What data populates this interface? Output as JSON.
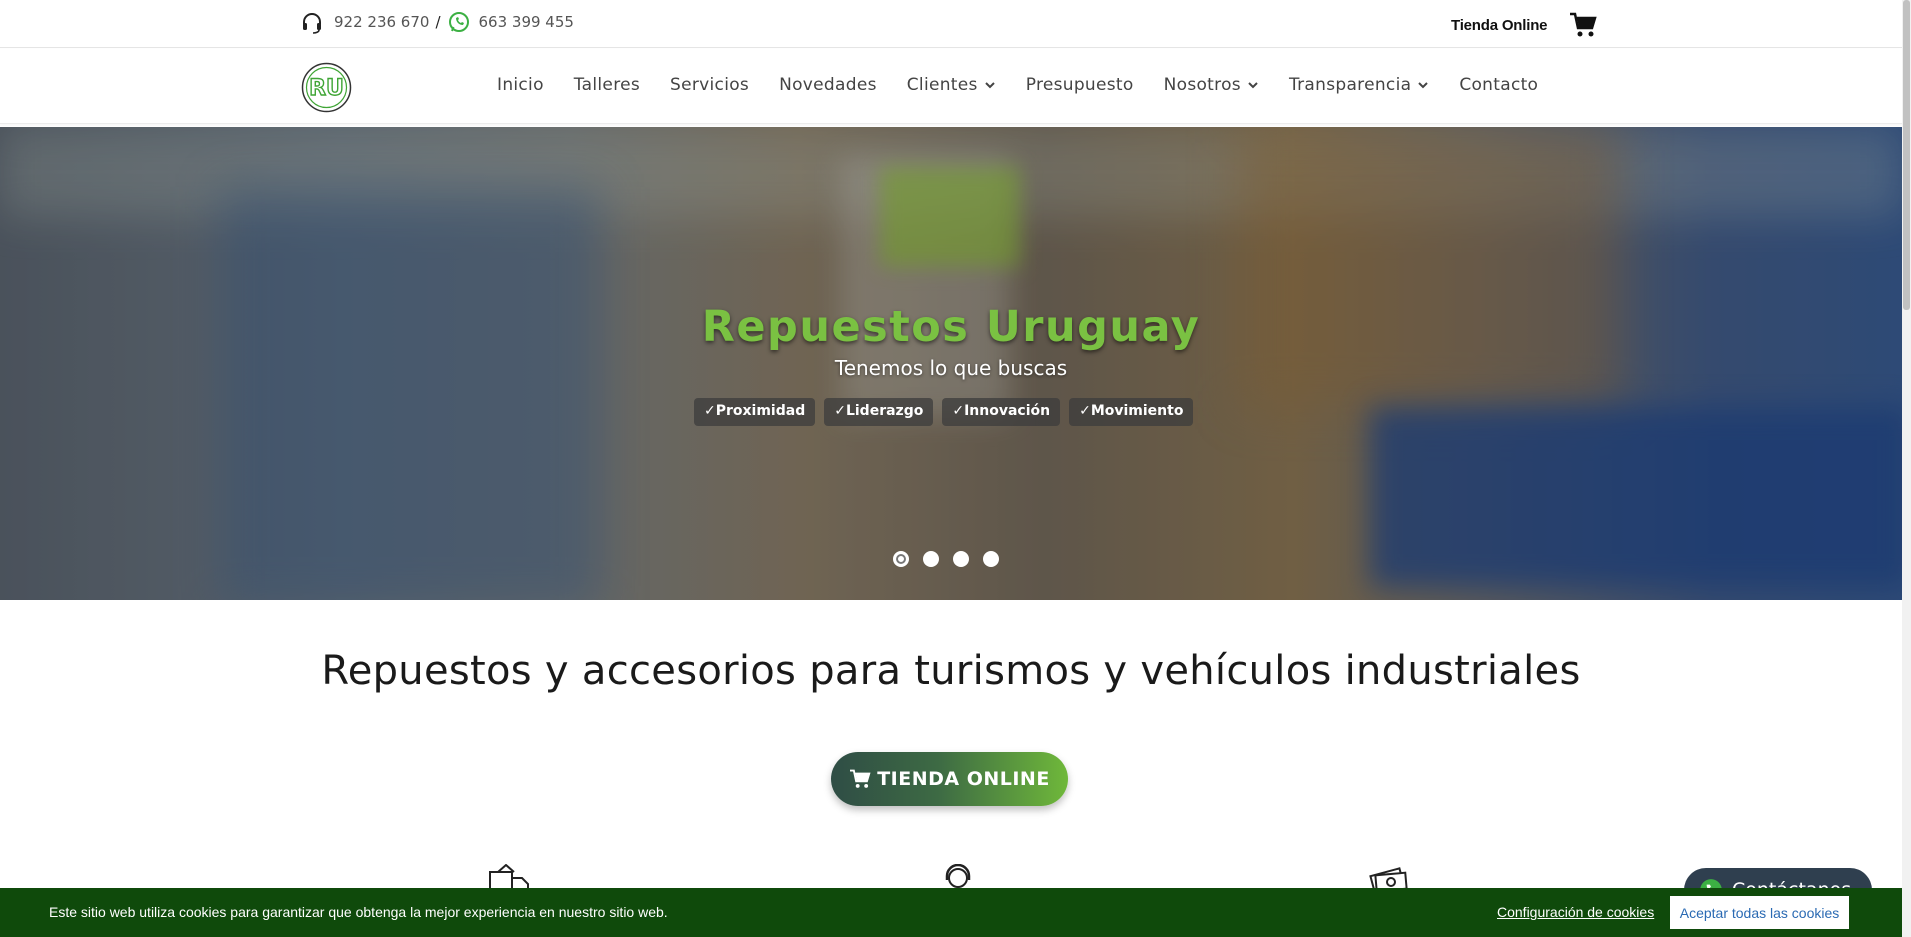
{
  "topbar": {
    "phone": "922 236 670",
    "separator": "/",
    "whatsapp": "663 399 455",
    "shop_label": "Tienda Online",
    "phone_icon": "headset-icon",
    "whatsapp_icon": "whatsapp-icon",
    "cart_icon": "cart-icon"
  },
  "nav": {
    "logo_text": "RU",
    "items": [
      {
        "label": "Inicio",
        "dropdown": false
      },
      {
        "label": "Talleres",
        "dropdown": false
      },
      {
        "label": "Servicios",
        "dropdown": false
      },
      {
        "label": "Novedades",
        "dropdown": false
      },
      {
        "label": "Clientes",
        "dropdown": true
      },
      {
        "label": "Presupuesto",
        "dropdown": false
      },
      {
        "label": "Nosotros",
        "dropdown": true
      },
      {
        "label": "Transparencia",
        "dropdown": true
      },
      {
        "label": "Contacto",
        "dropdown": false
      }
    ]
  },
  "hero": {
    "title": "Repuestos Uruguay",
    "subtitle": "Tenemos lo que buscas",
    "badges": [
      "✓Proximidad",
      "✓Liderazgo",
      "✓Innovación",
      "✓Movimiento"
    ],
    "slides": 4,
    "active_slide": 1
  },
  "main": {
    "headline": "Repuestos y accesorios para turismos y vehículos industriales",
    "cta_label": "TIENDA ONLINE",
    "feature_icons": [
      "delivery-icon",
      "support-icon",
      "money-icon"
    ]
  },
  "whatsapp_widget": {
    "label": "Contáctanos"
  },
  "cookie": {
    "message": "Este sitio web utiliza cookies para garantizar que obtenga la mejor experiencia en nuestro sitio web.",
    "settings_label": "Configuración de cookies",
    "accept_label": "Aceptar todas las cookies"
  },
  "colors": {
    "brand_green": "#7ac142",
    "cookie_bg": "#0f4a0b",
    "cta_dark": "#2f4d45"
  }
}
